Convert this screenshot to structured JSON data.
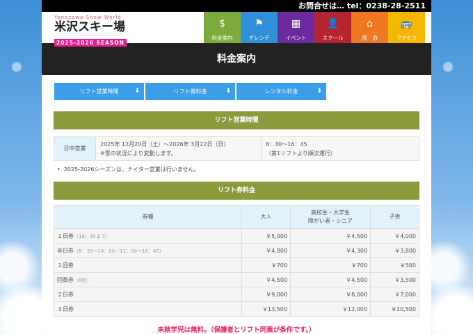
{
  "topbar": {
    "contact": "お問合せは… tel：0238-28-2511"
  },
  "logo": {
    "subtitle": "Yonezawa Snow World",
    "name": "米沢スキー場",
    "season": "2025-2026 SEASON"
  },
  "nav": [
    {
      "label": "料金案内",
      "icon": "$",
      "color": "#7cab3a"
    },
    {
      "label": "ゲレンデ",
      "icon": "⚑",
      "color": "#2f8fd8"
    },
    {
      "label": "イベント",
      "icon": "▦",
      "color": "#6b2a9e"
    },
    {
      "label": "スクール",
      "icon": "👤",
      "color": "#b5242e"
    },
    {
      "label": "宿　泊",
      "icon": "⌂",
      "color": "#f07820"
    },
    {
      "label": "アクセス",
      "icon": "🚌",
      "color": "#f5b800"
    }
  ],
  "page_title": "料金案内",
  "anchor_buttons": [
    "リフト営業時間",
    "リフト券料金",
    "レンタル料金"
  ],
  "hours": {
    "heading": "リフト営業時間",
    "label": "日中営業",
    "period": "2025年 12月20日（土）〜2026年 3月22日（日）",
    "period_note": "※雪の状況により変動します。",
    "time": "8：30〜16：45",
    "time_note": "（第1リフトより順次運行）",
    "note": "2025-2026シーズンは、ナイター営業は行いません。"
  },
  "prices": {
    "heading": "リフト券料金",
    "headers": [
      "券種",
      "大人",
      "高校生・大学生",
      "障がい者・シニア",
      "子供"
    ],
    "rows": [
      {
        "name": "１日券",
        "note": "（16：45まで）",
        "adult": "￥5,000",
        "student": "￥4,500",
        "child": "￥4,000"
      },
      {
        "name": "半日券",
        "note": "（8：30〜14：00／11：00〜16：45）",
        "adult": "￥4,800",
        "student": "￥4,300",
        "child": "￥3,800"
      },
      {
        "name": "１回券",
        "note": "",
        "adult": "￥700",
        "student": "￥700",
        "child": "￥500"
      },
      {
        "name": "回数券",
        "note": "（8回）",
        "adult": "￥4,500",
        "student": "￥4,500",
        "child": "￥3,500"
      },
      {
        "name": "２日券",
        "note": "",
        "adult": "￥9,000",
        "student": "￥8,000",
        "child": "￥7,000"
      },
      {
        "name": "３日券",
        "note": "",
        "adult": "￥13,500",
        "student": "￥12,000",
        "child": "￥10,500"
      }
    ],
    "free_note": "未就学児は無料。（保護者とリフト同乗が条件です。）"
  }
}
